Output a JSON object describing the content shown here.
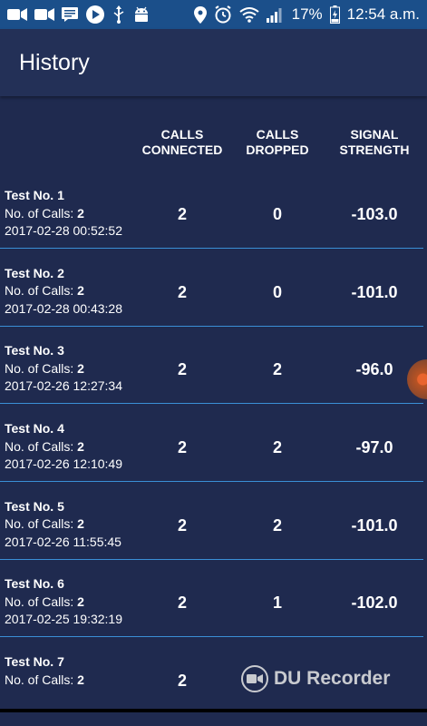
{
  "status_bar": {
    "battery": "17%",
    "time": "12:54 a.m.",
    "left_icons": [
      "video-camera-icon",
      "video-camera-icon",
      "message-icon",
      "play-icon",
      "usb-icon",
      "android-icon"
    ],
    "right_icons": [
      "location-icon",
      "alarm-icon",
      "wifi-icon",
      "signal-icon",
      "battery-icon"
    ]
  },
  "app_bar": {
    "title": "History"
  },
  "table": {
    "headers": [
      "CALLS\nCONNECTED",
      "CALLS\nDROPPED",
      "SIGNAL\nSTRENGTH"
    ],
    "calls_label": "No. of Calls: ",
    "rows": [
      {
        "title": "Test No. 1",
        "calls": "2",
        "date": "2017-02-28 00:52:52",
        "connected": "2",
        "dropped": "0",
        "signal": "-103.0"
      },
      {
        "title": "Test No. 2",
        "calls": "2",
        "date": "2017-02-28 00:43:28",
        "connected": "2",
        "dropped": "0",
        "signal": "-101.0"
      },
      {
        "title": "Test No. 3",
        "calls": "2",
        "date": "2017-02-26 12:27:34",
        "connected": "2",
        "dropped": "2",
        "signal": "-96.0"
      },
      {
        "title": "Test No. 4",
        "calls": "2",
        "date": "2017-02-26 12:10:49",
        "connected": "2",
        "dropped": "2",
        "signal": "-97.0"
      },
      {
        "title": "Test No. 5",
        "calls": "2",
        "date": "2017-02-26 11:55:45",
        "connected": "2",
        "dropped": "2",
        "signal": "-101.0"
      },
      {
        "title": "Test No. 6",
        "calls": "2",
        "date": "2017-02-25 19:32:19",
        "connected": "2",
        "dropped": "1",
        "signal": "-102.0"
      },
      {
        "title": "Test No. 7",
        "calls": "2",
        "date": "",
        "connected": "2",
        "dropped": "",
        "signal": ""
      }
    ]
  },
  "watermark": {
    "text": "DU Recorder"
  },
  "colors": {
    "background": "#1f2a4f",
    "status_bar": "#1b4f8a",
    "app_bar": "#233057",
    "divider": "#3a8fd6"
  }
}
